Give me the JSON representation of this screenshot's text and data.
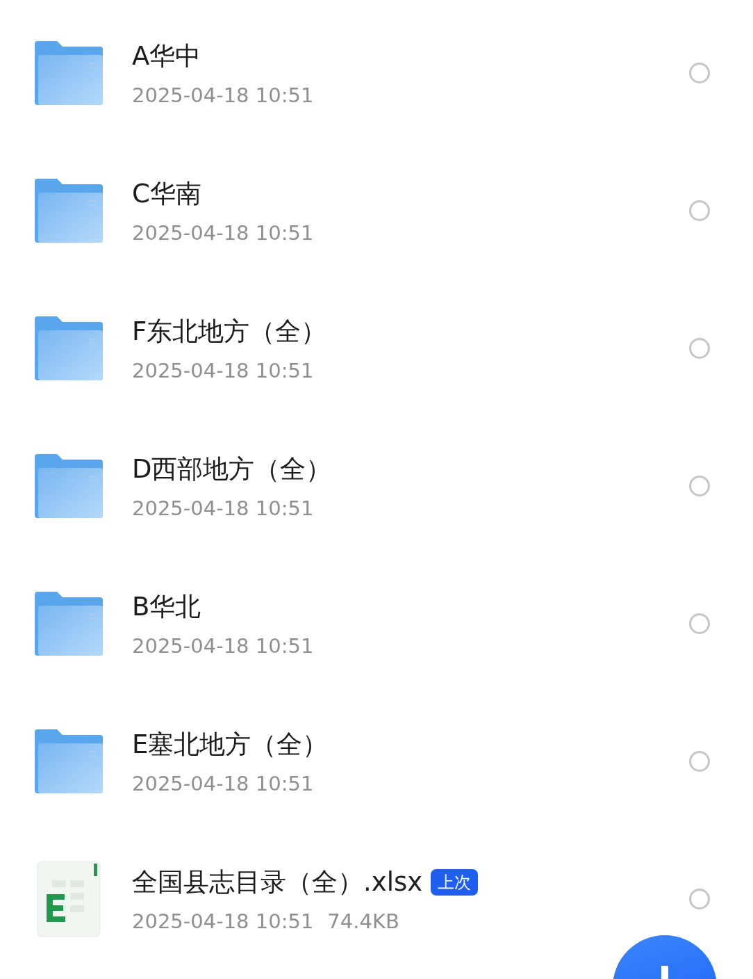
{
  "files": [
    {
      "kind": "folder",
      "name": "A华中",
      "date": "2025-04-18 10:51",
      "selected": false
    },
    {
      "kind": "folder",
      "name": "C华南",
      "date": "2025-04-18 10:51",
      "selected": false
    },
    {
      "kind": "folder",
      "name": "F东北地方（全）",
      "date": "2025-04-18 10:51",
      "selected": false
    },
    {
      "kind": "folder",
      "name": "D西部地方（全）",
      "date": "2025-04-18 10:51",
      "selected": false
    },
    {
      "kind": "folder",
      "name": "B华北",
      "date": "2025-04-18 10:51",
      "selected": false
    },
    {
      "kind": "folder",
      "name": "E塞北地方（全）",
      "date": "2025-04-18 10:51",
      "selected": false
    },
    {
      "kind": "spreadsheet",
      "name": "全国县志目录（全）.xlsx",
      "badge": "上次",
      "date": "2025-04-18 10:51",
      "size": "74.4KB",
      "selected": false
    }
  ]
}
